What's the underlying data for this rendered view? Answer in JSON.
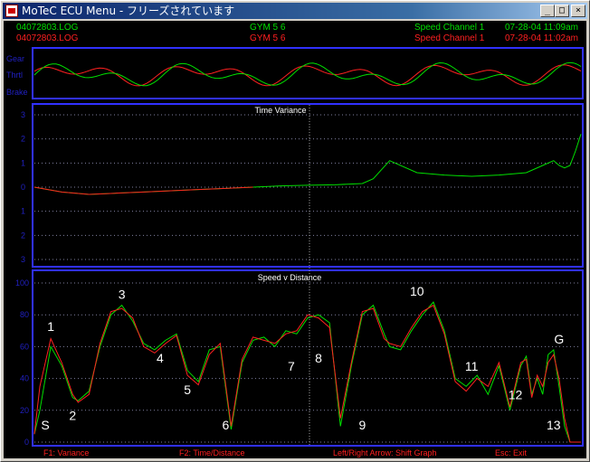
{
  "window": {
    "title": "MoTeC ECU Menu - フリーズされています",
    "minimize_glyph": "_",
    "maximize_glyph": "□",
    "close_glyph": "×",
    "app_icon": "motec-icon"
  },
  "header": {
    "log1": {
      "file": "04072803.LOG",
      "session": "GYM 5 6",
      "channel": "Speed Channel 1",
      "datetime": "07-28-04  11:09am",
      "color": "#00e000"
    },
    "log2": {
      "file": "04072803.LOG",
      "session": "GYM 5 6",
      "channel": "Speed Channel 1",
      "datetime": "07-28-04  11:02am",
      "color": "#ff2020"
    }
  },
  "colors": {
    "panel_bg": "#000000",
    "border": "#3030ff",
    "axis_text": "#2020c0",
    "trace1": "#00e000",
    "trace2": "#ff2020",
    "grid": "#8080a0"
  },
  "strip": {
    "labels": [
      "Gear",
      "Thrtl",
      "Brake"
    ]
  },
  "variance_chart": {
    "title": "Time Variance",
    "ticks": [
      "3",
      "2",
      "1",
      "0",
      "1",
      "2",
      "3"
    ]
  },
  "speed_chart": {
    "title": "Speed v Distance",
    "ticks": [
      "100",
      "80",
      "60",
      "40",
      "20",
      "0"
    ],
    "corners": [
      "S",
      "1",
      "2",
      "3",
      "4",
      "5",
      "6",
      "7",
      "8",
      "9",
      "10",
      "11",
      "12",
      "13",
      "G"
    ]
  },
  "footer": {
    "f1": "F1: Variance",
    "f2": "F2: Time/Distance",
    "arrows": "Left/Right Arrow: Shift Graph",
    "esc": "Esc: Exit"
  },
  "chart_data": [
    {
      "type": "line",
      "title": "Time Variance",
      "xlabel": "",
      "ylabel": "",
      "ylim": [
        -3,
        3
      ],
      "x": [
        0,
        0.05,
        0.1,
        0.15,
        0.2,
        0.25,
        0.3,
        0.35,
        0.4,
        0.45,
        0.5,
        0.55,
        0.6,
        0.62,
        0.65,
        0.7,
        0.75,
        0.8,
        0.85,
        0.9,
        0.93,
        0.95,
        0.96,
        0.97,
        0.98,
        0.99,
        1.0
      ],
      "series": [
        {
          "values": [
            0,
            -0.2,
            -0.3,
            -0.25,
            -0.2,
            -0.15,
            -0.1,
            -0.05,
            0.0,
            0.05,
            0.08,
            0.1,
            0.15,
            0.35,
            1.1,
            0.6,
            0.5,
            0.45,
            0.5,
            0.6,
            0.9,
            1.1,
            0.9,
            0.8,
            0.9,
            1.5,
            2.2
          ]
        },
        {
          "values": [
            0,
            -0.2,
            -0.3,
            -0.25,
            -0.2,
            -0.15,
            -0.1,
            -0.05,
            0.0,
            0.05,
            0.08,
            0.1,
            0.15,
            0.35,
            1.1,
            0.6,
            0.5,
            0.45,
            0.5,
            0.6,
            0.9,
            1.1,
            0.9,
            0.8,
            0.9,
            1.5,
            2.2
          ]
        }
      ]
    },
    {
      "type": "line",
      "title": "Speed v Distance",
      "xlabel": "",
      "ylabel": "",
      "ylim": [
        0,
        100
      ],
      "x": [
        0,
        0.01,
        0.03,
        0.05,
        0.07,
        0.08,
        0.1,
        0.12,
        0.14,
        0.16,
        0.18,
        0.2,
        0.22,
        0.24,
        0.26,
        0.28,
        0.3,
        0.32,
        0.34,
        0.36,
        0.38,
        0.4,
        0.42,
        0.44,
        0.46,
        0.48,
        0.5,
        0.52,
        0.54,
        0.56,
        0.58,
        0.6,
        0.62,
        0.64,
        0.65,
        0.67,
        0.69,
        0.71,
        0.73,
        0.75,
        0.77,
        0.79,
        0.81,
        0.83,
        0.85,
        0.87,
        0.89,
        0.9,
        0.91,
        0.92,
        0.93,
        0.94,
        0.95,
        0.96,
        0.97,
        0.98,
        0.99,
        1.0
      ],
      "series": [
        {
          "values": [
            5,
            20,
            60,
            48,
            28,
            26,
            32,
            60,
            80,
            86,
            76,
            62,
            58,
            64,
            68,
            45,
            38,
            58,
            60,
            8,
            50,
            64,
            66,
            60,
            70,
            68,
            78,
            80,
            75,
            10,
            48,
            80,
            86,
            68,
            60,
            58,
            70,
            80,
            88,
            70,
            40,
            35,
            42,
            30,
            48,
            20,
            48,
            54,
            30,
            40,
            30,
            55,
            58,
            35,
            10,
            0,
            0,
            0
          ]
        },
        {
          "values": [
            5,
            35,
            65,
            50,
            30,
            25,
            30,
            62,
            82,
            84,
            78,
            60,
            56,
            62,
            67,
            42,
            36,
            55,
            62,
            10,
            52,
            66,
            64,
            62,
            68,
            70,
            80,
            78,
            72,
            15,
            50,
            82,
            84,
            65,
            62,
            60,
            72,
            82,
            86,
            68,
            38,
            32,
            40,
            35,
            50,
            22,
            50,
            52,
            28,
            42,
            35,
            50,
            55,
            40,
            15,
            0,
            0,
            0
          ]
        }
      ]
    }
  ]
}
